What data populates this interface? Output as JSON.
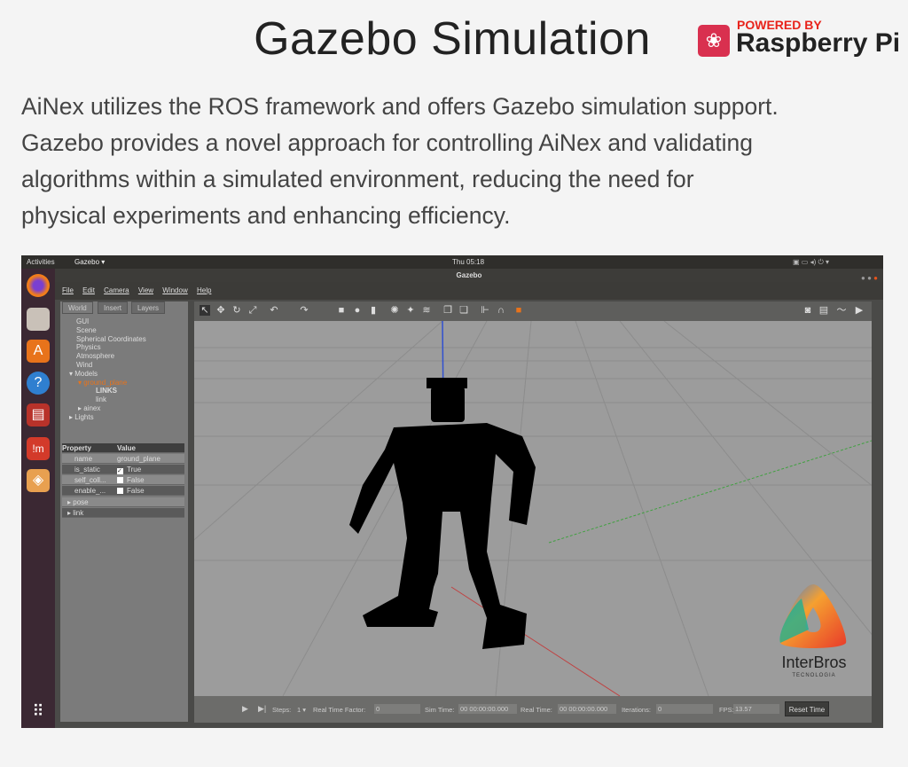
{
  "header": {
    "title": "Gazebo Simulation",
    "badge": {
      "powered_by": "POWERED BY",
      "brand": "Raspberry Pi"
    }
  },
  "description": [
    "AiNex utilizes the ROS framework and offers Gazebo simulation support.",
    "Gazebo provides a novel approach for controlling AiNex and validating",
    "algorithms within a simulated environment, reducing the need for",
    "physical experiments and enhancing efficiency."
  ],
  "desktop": {
    "activities": "Activities",
    "app_menu": "Gazebo ▾",
    "clock": "Thu 05:18",
    "window_title": "Gazebo",
    "dock": [
      "firefox-icon",
      "files-icon",
      "software-icon",
      "help-icon",
      "monitor-icon",
      "terminal-icon",
      "gazebo-icon",
      "apps-grid-icon"
    ]
  },
  "menu": [
    "File",
    "Edit",
    "Camera",
    "View",
    "Window",
    "Help"
  ],
  "left_panel": {
    "tabs": [
      "World",
      "Insert",
      "Layers"
    ],
    "tree": [
      "GUI",
      "Scene",
      "Spherical Coordinates",
      "Physics",
      "Atmosphere",
      "Wind",
      "▾ Models",
      "▾ ground_plane",
      "LINKS",
      "link",
      "▸ ainex",
      "▸ Lights"
    ],
    "prop_header": {
      "property": "Property",
      "value": "Value"
    },
    "props": [
      {
        "k": "name",
        "v": "ground_plane"
      },
      {
        "k": "is_static",
        "v": "True",
        "checked": true
      },
      {
        "k": "self_coll...",
        "v": "False",
        "checked": false
      },
      {
        "k": "enable_...",
        "v": "False",
        "checked": false
      }
    ],
    "groups": [
      "▸ pose",
      "▸ link"
    ]
  },
  "bottom": {
    "steps_label": "Steps:",
    "steps": "1 ▾",
    "rtf_label": "Real Time Factor:",
    "rtf": "0",
    "sim_label": "Sim Time:",
    "sim": "00 00:00:00.000",
    "real_label": "Real Time:",
    "real": "00 00:00:00.000",
    "iter_label": "Iterations:",
    "iter": "0",
    "fps_label": "FPS:",
    "fps": "13.57",
    "reset": "Reset Time"
  },
  "watermark": {
    "name": "InterBros",
    "sub": "TECNOLOGIA"
  },
  "colors": {
    "accent": "#e8731b",
    "raspberry": "#d9304f",
    "viewport": "#9c9c9c"
  }
}
